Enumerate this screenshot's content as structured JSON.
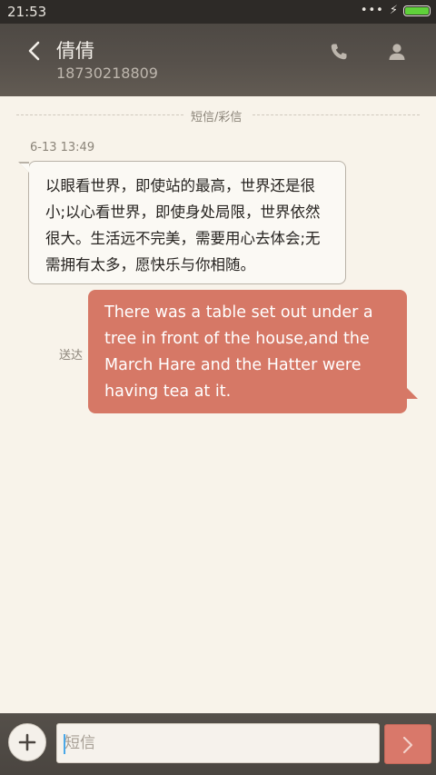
{
  "status_bar": {
    "time": "21:53",
    "icons": [
      "more-dots-icon",
      "charging-bolt-icon",
      "battery-icon"
    ],
    "battery_color": "#5fd13a"
  },
  "header": {
    "contact_name": "倩倩",
    "contact_number": "18730218809",
    "icons": [
      "back-icon",
      "call-icon",
      "contact-icon"
    ]
  },
  "conversation": {
    "channel_label": "短信/彩信",
    "messages": [
      {
        "direction": "incoming",
        "timestamp": "6-13 13:49",
        "text": "以眼看世界，即使站的最高，世界还是很小;以心看世界，即使身处局限，世界依然很大。生活远不完美，需要用心去体会;无需拥有太多，愿快乐与你相随。"
      },
      {
        "direction": "outgoing",
        "status": "送达",
        "text": "There was a table set out under a tree in front of the house,and the March Hare and the Hatter were having tea at it."
      }
    ]
  },
  "composer": {
    "placeholder": "短信",
    "value": "",
    "icons": [
      "add-icon",
      "send-arrow-icon"
    ]
  },
  "colors": {
    "background": "#f8f3ea",
    "header": "#57514b",
    "outgoing_bubble": "#d67866",
    "incoming_bubble": "#fbf9f4",
    "send_button": "#d9786a"
  }
}
